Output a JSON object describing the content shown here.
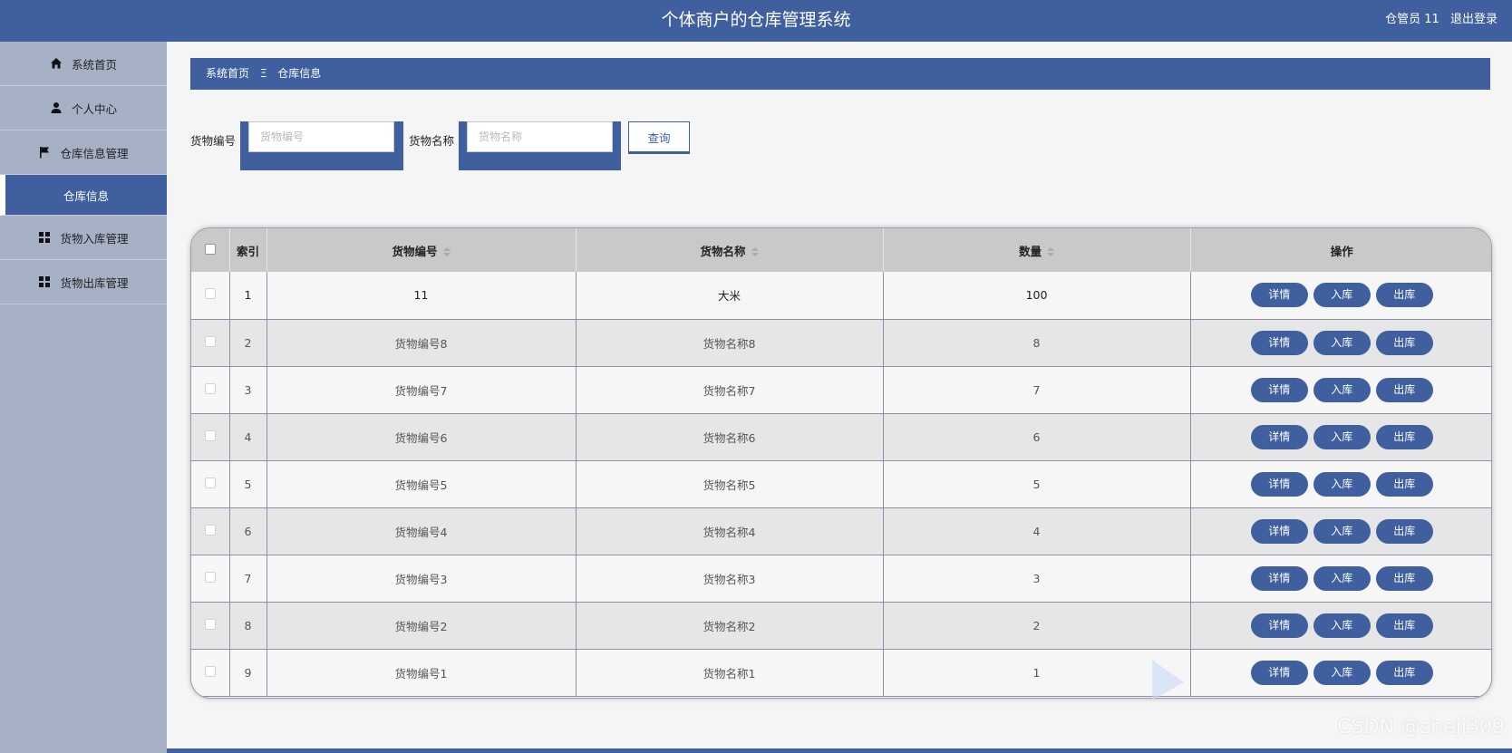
{
  "header": {
    "title": "个体商户的仓库管理系统",
    "role": "仓管员 11",
    "logout": "退出登录"
  },
  "sidebar": {
    "items": [
      {
        "label": "系统首页",
        "icon": "home-icon"
      },
      {
        "label": "个人中心",
        "icon": "user-icon"
      },
      {
        "label": "仓库信息管理",
        "icon": "flag-icon"
      },
      {
        "label": "仓库信息",
        "icon": ""
      },
      {
        "label": "货物入库管理",
        "icon": "grid-icon"
      },
      {
        "label": "货物出库管理",
        "icon": "grid-icon"
      }
    ]
  },
  "breadcrumb": {
    "home": "系统首页",
    "separator": "Ξ",
    "current": "仓库信息"
  },
  "search": {
    "code_label": "货物编号",
    "code_placeholder": "货物编号",
    "name_label": "货物名称",
    "name_placeholder": "货物名称",
    "query_button": "查询"
  },
  "table": {
    "columns": [
      "索引",
      "货物编号",
      "货物名称",
      "数量",
      "操作"
    ],
    "actions": [
      "详情",
      "入库",
      "出库"
    ],
    "rows": [
      {
        "index": "1",
        "code": "11",
        "name": "大米",
        "qty": "100"
      },
      {
        "index": "2",
        "code": "货物编号8",
        "name": "货物名称8",
        "qty": "8"
      },
      {
        "index": "3",
        "code": "货物编号7",
        "name": "货物名称7",
        "qty": "7"
      },
      {
        "index": "4",
        "code": "货物编号6",
        "name": "货物名称6",
        "qty": "6"
      },
      {
        "index": "5",
        "code": "货物编号5",
        "name": "货物名称5",
        "qty": "5"
      },
      {
        "index": "6",
        "code": "货物编号4",
        "name": "货物名称4",
        "qty": "4"
      },
      {
        "index": "7",
        "code": "货物编号3",
        "name": "货物名称3",
        "qty": "3"
      },
      {
        "index": "8",
        "code": "货物编号2",
        "name": "货物名称2",
        "qty": "2"
      },
      {
        "index": "9",
        "code": "货物编号1",
        "name": "货物名称1",
        "qty": "1"
      }
    ]
  },
  "watermark": "CSDN @sheji309",
  "colors": {
    "primary": "#3f5f9e",
    "sidebar": "#a7b1c6"
  }
}
